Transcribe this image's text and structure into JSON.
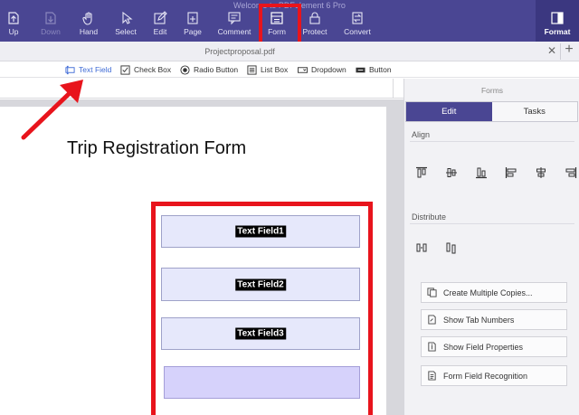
{
  "window": {
    "title": "Welcome to PDFelement 6 Pro"
  },
  "toolbar": {
    "items": [
      {
        "label": "Up",
        "icon": "arrow-up-icon"
      },
      {
        "label": "Down",
        "icon": "arrow-down-icon"
      },
      {
        "label": "Hand",
        "icon": "hand-icon"
      },
      {
        "label": "Select",
        "icon": "cursor-icon"
      },
      {
        "label": "Edit",
        "icon": "edit-icon"
      },
      {
        "label": "Page",
        "icon": "page-icon"
      },
      {
        "label": "Comment",
        "icon": "comment-icon"
      },
      {
        "label": "Form",
        "icon": "form-icon"
      },
      {
        "label": "Protect",
        "icon": "lock-icon"
      },
      {
        "label": "Convert",
        "icon": "convert-icon"
      }
    ],
    "format_label": "Format"
  },
  "tab": {
    "title": "Projectproposal.pdf"
  },
  "form_tools": [
    {
      "label": "Text Field"
    },
    {
      "label": "Check Box"
    },
    {
      "label": "Radio Button"
    },
    {
      "label": "List Box"
    },
    {
      "label": "Dropdown"
    },
    {
      "label": "Button"
    }
  ],
  "document": {
    "title": "Trip Registration Form",
    "fields": [
      {
        "label": "Text Field1"
      },
      {
        "label": "Text Field2"
      },
      {
        "label": "Text Field3"
      }
    ]
  },
  "panel": {
    "title": "Forms",
    "tabs": [
      {
        "label": "Edit"
      },
      {
        "label": "Tasks"
      }
    ],
    "align_label": "Align",
    "distribute_label": "Distribute",
    "actions": [
      {
        "label": "Create Multiple Copies..."
      },
      {
        "label": "Show Tab Numbers"
      },
      {
        "label": "Show Field Properties"
      },
      {
        "label": "Form Field Recognition"
      }
    ]
  },
  "colors": {
    "toolbar": "#4a4693",
    "highlight": "#e8141c",
    "field": "#e6e8fb",
    "active_tool": "#3f6bd6"
  }
}
